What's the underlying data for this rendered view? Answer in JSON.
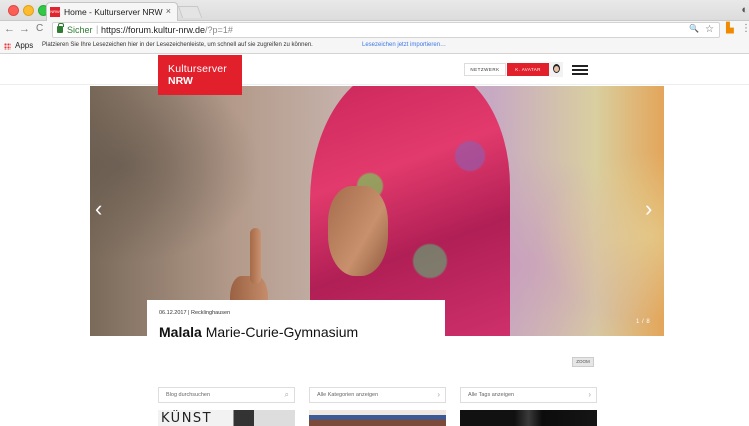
{
  "browser": {
    "tab_title": "Home - Kulturserver NRW",
    "tab_favicon_text": "NRW",
    "close_glyph": "×",
    "secure_label": "Sicher",
    "url_host": "https://forum.kultur-nrw.de",
    "url_rest": "/?p=1#",
    "back_glyph": "←",
    "forward_glyph": "→",
    "reload_glyph": "C",
    "zoom_glyph": "🔍",
    "star_glyph": "☆",
    "bookmarks": {
      "apps_label": "Apps",
      "hint": "Platzieren Sie Ihre Lesezeichen hier in der Lesezeichenleiste, um schnell auf sie zugreifen zu können.",
      "import_link": "Lesezeichen jetzt importieren…"
    }
  },
  "site": {
    "logo": {
      "line1": "Kulturserver",
      "line2": "NRW"
    },
    "header": {
      "netzwerk_label": "NETZWERK",
      "avatar_label": "K. AVATAR"
    }
  },
  "hero": {
    "prev_glyph": "‹",
    "next_glyph": "›",
    "counter": "1 / 8",
    "caption": {
      "meta": "06.12.2017 | Recklinghausen",
      "title_bold": "Malala",
      "title_rest": "Marie-Curie-Gymnasium"
    }
  },
  "zoom_tag": "ZOOM",
  "filters": {
    "search_placeholder": "Blog durchsuchen",
    "categories": "Alle Kategorien anzeigen",
    "tags": "Alle Tags anzeigen",
    "search_glyph": "⌕",
    "chevron_glyph": "›"
  },
  "thumbnails": {
    "first_text": "KÜNST"
  },
  "icons": {
    "menu": "hamburger-icon",
    "search": "search-icon",
    "chevron": "chevron-right-icon"
  },
  "colors": {
    "brand_red": "#e2202c",
    "secure_green": "#2e7d32",
    "link_blue": "#3b78e7"
  }
}
